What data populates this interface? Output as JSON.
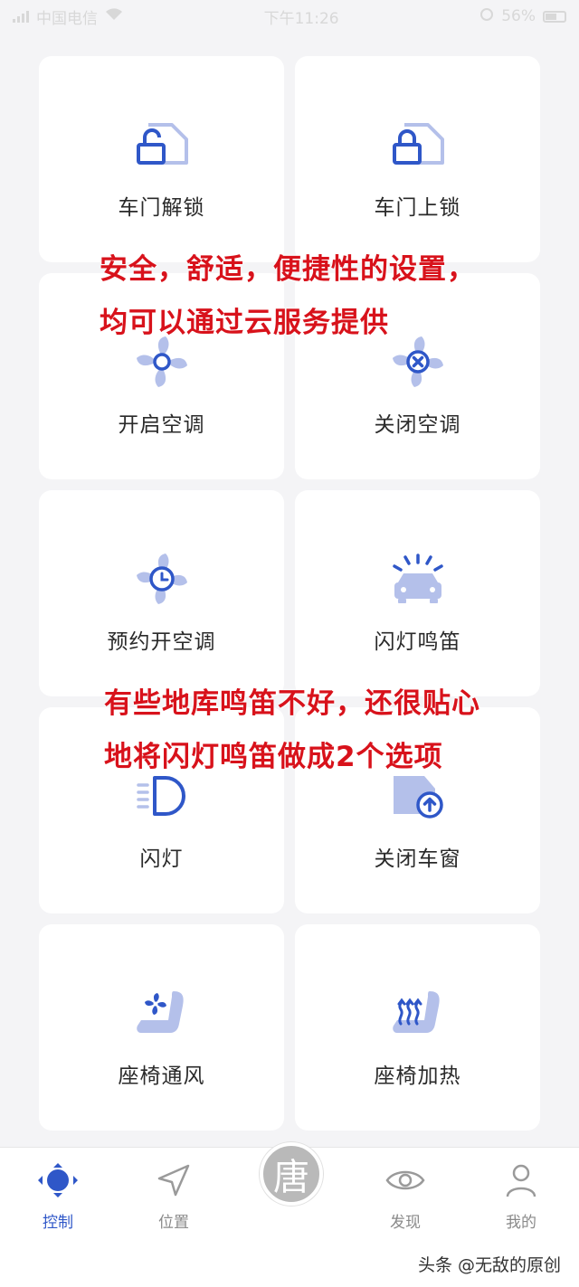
{
  "status_bar": {
    "carrier": "中国电信",
    "time": "下午11:26",
    "battery": "56%"
  },
  "controls": [
    {
      "label": "车门解锁",
      "icon": "door-unlock-icon"
    },
    {
      "label": "车门上锁",
      "icon": "door-lock-icon"
    },
    {
      "label": "开启空调",
      "icon": "fan-icon"
    },
    {
      "label": "关闭空调",
      "icon": "fan-off-icon"
    },
    {
      "label": "预约开空调",
      "icon": "fan-clock-icon"
    },
    {
      "label": "闪灯鸣笛",
      "icon": "car-flash-icon"
    },
    {
      "label": "闪灯",
      "icon": "headlight-icon"
    },
    {
      "label": "关闭车窗",
      "icon": "window-close-icon"
    },
    {
      "label": "座椅通风",
      "icon": "seat-vent-icon"
    },
    {
      "label": "座椅加热",
      "icon": "seat-heat-icon"
    }
  ],
  "annotations": {
    "line1": "安全，舒适，便捷性的设置，",
    "line2": "均可以通过云服务提供",
    "line3": "有些地库鸣笛不好，还很贴心",
    "line4": "地将闪灯鸣笛做成2个选项"
  },
  "tabbar": {
    "tabs": [
      {
        "label": "控制",
        "icon": "control-dpad-icon",
        "active": true
      },
      {
        "label": "位置",
        "icon": "location-arrow-icon",
        "active": false
      },
      {
        "label": "发现",
        "icon": "eye-icon",
        "active": false
      },
      {
        "label": "我的",
        "icon": "person-icon",
        "active": false
      }
    ],
    "center_char": "唐"
  },
  "watermark": "头条 @无敌的原创",
  "colors": {
    "accent": "#2f57c8",
    "icon_light": "#b4c0ea",
    "annotation_red": "#d8121b"
  }
}
